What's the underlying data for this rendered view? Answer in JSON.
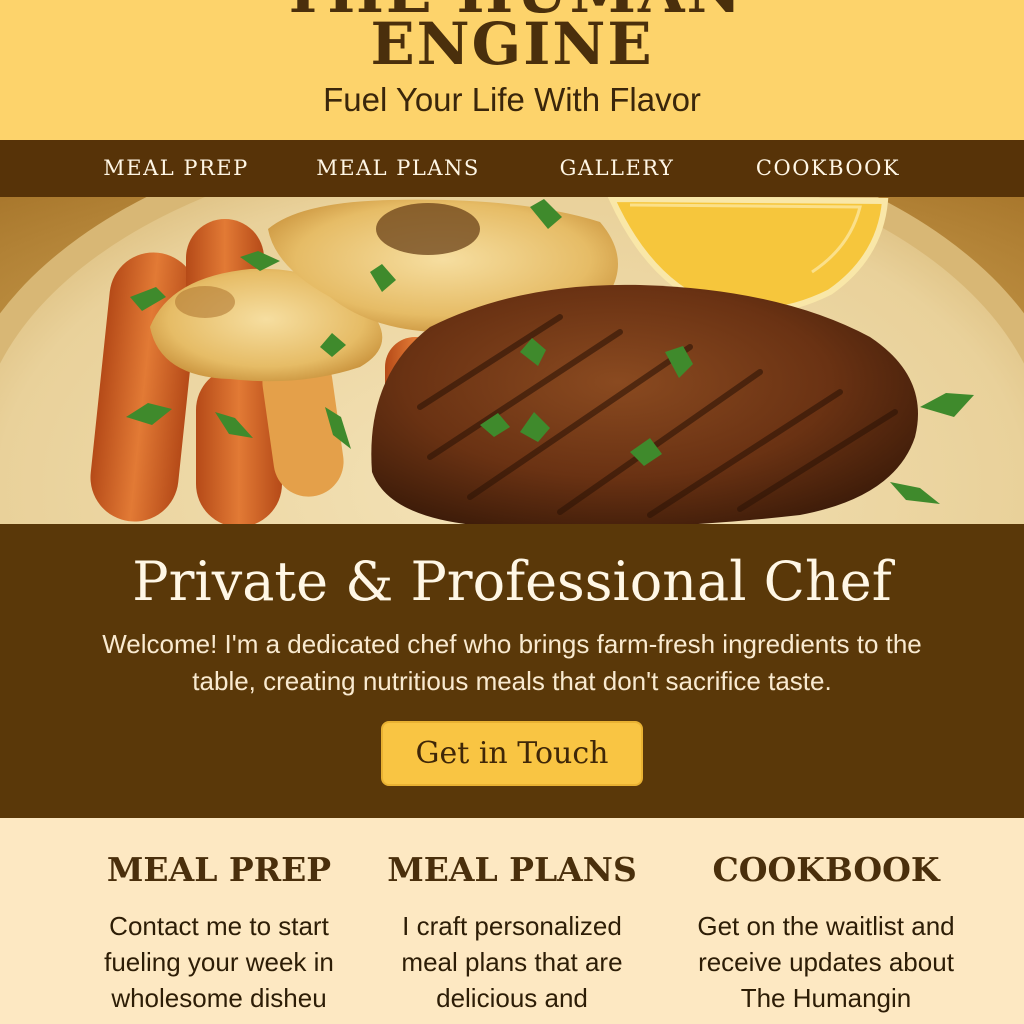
{
  "header": {
    "title_clipped": "THE HUMAN",
    "title": "ENGINE",
    "tagline": "Fuel Your Life With Flavor"
  },
  "nav": {
    "items": [
      {
        "label": "MEAL PREP"
      },
      {
        "label": "MEAL PLANS"
      },
      {
        "label": "GALLERY"
      },
      {
        "label": "COOKBOOK"
      }
    ]
  },
  "hero": {
    "image": "plate-of-grilled-steak-chicken-carrots-lemon"
  },
  "intro": {
    "heading": "Private & Professional Chef",
    "text": "Welcome! I'm a dedicated chef who brings farm-fresh ingredients to the table, creating nutritious meals that don't sacrifice taste.",
    "cta_label": "Get in Touch"
  },
  "features": [
    {
      "title": "MEAL PREP",
      "text": "Contact me to start fueling your week in wholesome disheu"
    },
    {
      "title": "MEAL PLANS",
      "text": "I craft personalized meal plans that are delicious and"
    },
    {
      "title": "COOKBOOK",
      "text": "Get on the waitlist and receive updates about The Humangin"
    }
  ],
  "colors": {
    "header_bg": "#fdd36b",
    "nav_bg": "#573308",
    "intro_bg": "#5a3809",
    "cta_bg": "#f9c543",
    "features_bg": "#fde8c2"
  }
}
